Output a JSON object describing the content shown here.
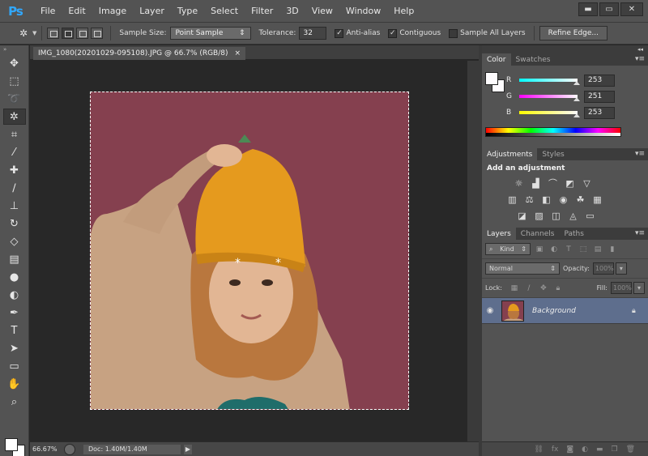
{
  "app": {
    "logo": "Ps",
    "menus": [
      "File",
      "Edit",
      "Image",
      "Layer",
      "Type",
      "Select",
      "Filter",
      "3D",
      "View",
      "Window",
      "Help"
    ],
    "window_controls": {
      "minimize": "▬",
      "maximize": "▭",
      "close": "✕"
    }
  },
  "options": {
    "sample_size_label": "Sample Size:",
    "sample_size_value": "Point Sample",
    "tolerance_label": "Tolerance:",
    "tolerance_value": "32",
    "anti_alias_label": "Anti-alias",
    "anti_alias_checked": true,
    "contiguous_label": "Contiguous",
    "contiguous_checked": true,
    "sample_all_layers_label": "Sample All Layers",
    "sample_all_layers_checked": false,
    "refine_edge_label": "Refine Edge..."
  },
  "tools": [
    "move-tool",
    "marquee-tool",
    "lasso-tool",
    "magic-wand-tool",
    "crop-tool",
    "eyedropper-tool",
    "spot-healing-tool",
    "brush-tool",
    "clone-stamp-tool",
    "history-brush-tool",
    "eraser-tool",
    "gradient-tool",
    "blur-tool",
    "dodge-tool",
    "pen-tool",
    "type-tool",
    "path-selection-tool",
    "rectangle-tool",
    "hand-tool",
    "zoom-tool"
  ],
  "document": {
    "tab_title": "IMG_1080(20201029-095108).JPG @ 66.7% (RGB/8)",
    "close": "×",
    "zoom": "66.67%",
    "doc_info": "Doc: 1.40M/1.40M",
    "image_bg": "#85404f"
  },
  "color_panel": {
    "tabs": [
      "Color",
      "Swatches"
    ],
    "channels": [
      {
        "name": "R",
        "value": "253",
        "gradient": "linear-gradient(to right, #00fbfd, #fdfbfd)",
        "level": 0.992
      },
      {
        "name": "G",
        "value": "251",
        "gradient": "linear-gradient(to right, #fd00fd, #fdfbfd)",
        "level": 0.984
      },
      {
        "name": "B",
        "value": "253",
        "gradient": "linear-gradient(to right, #fdfb00, #fdfbfd)",
        "level": 0.992
      }
    ],
    "foreground": "#fdfbfd"
  },
  "adjustments_panel": {
    "tabs": [
      "Adjustments",
      "Styles"
    ],
    "title": "Add an adjustment",
    "row1": [
      "brightness-contrast-icon",
      "levels-icon",
      "curves-icon",
      "exposure-icon",
      "vibrance-icon"
    ],
    "row2": [
      "hue-saturation-icon",
      "color-balance-icon",
      "black-white-icon",
      "photo-filter-icon",
      "channel-mixer-icon",
      "color-lookup-icon"
    ],
    "row3": [
      "invert-icon",
      "posterize-icon",
      "threshold-icon",
      "selective-color-icon",
      "gradient-map-icon"
    ]
  },
  "layers_panel": {
    "tabs": [
      "Layers",
      "Channels",
      "Paths"
    ],
    "filter_kind": "Kind",
    "blend_mode": "Normal",
    "opacity_label": "Opacity:",
    "opacity_value": "100%",
    "lock_label": "Lock:",
    "fill_label": "Fill:",
    "fill_value": "100%",
    "layer_name": "Background",
    "footer_icons": [
      "link-icon",
      "fx-icon",
      "mask-icon",
      "adjustment-layer-icon",
      "group-icon",
      "new-layer-icon",
      "trash-icon"
    ]
  }
}
